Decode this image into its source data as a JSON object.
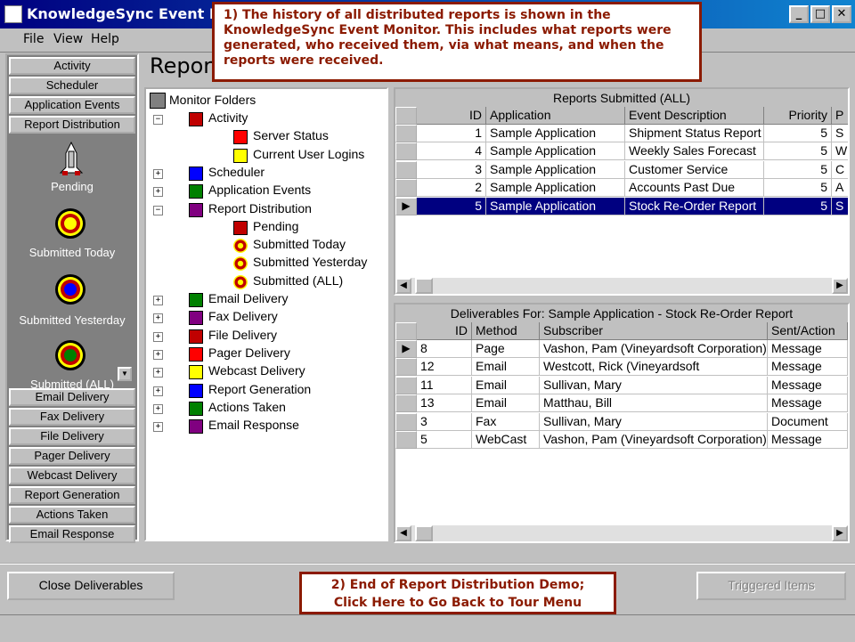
{
  "window": {
    "title": "KnowledgeSync Event Monitor",
    "min": "_",
    "max": "□",
    "close": "✕"
  },
  "menu": [
    "File",
    "View",
    "Help"
  ],
  "nav": {
    "top": [
      "Activity",
      "Scheduler",
      "Application Events",
      "Report Distribution"
    ],
    "icons": [
      {
        "label": "Pending",
        "icon": "shuttle-icon"
      },
      {
        "label": "Submitted Today",
        "icon": "target-icon",
        "center": "#ffff00"
      },
      {
        "label": "Submitted Yesterday",
        "icon": "target-icon",
        "center": "#0000ff"
      },
      {
        "label": "Submitted (ALL)",
        "icon": "target-icon",
        "center": "#008000"
      }
    ],
    "bottom": [
      "Email Delivery",
      "Fax Delivery",
      "File Delivery",
      "Pager Delivery",
      "Webcast Delivery",
      "Report Generation",
      "Actions Taken",
      "Email Response"
    ]
  },
  "heading": "Report",
  "tree": {
    "root": "Monitor Folders",
    "nodes": [
      {
        "label": "Activity",
        "level": 1,
        "pm": "−",
        "icon": "activity-icon"
      },
      {
        "label": "Server Status",
        "level": 2,
        "icon": "server-icon"
      },
      {
        "label": "Current User Logins",
        "level": 2,
        "icon": "users-icon"
      },
      {
        "label": "Scheduler",
        "level": 1,
        "pm": "+",
        "icon": "scheduler-icon"
      },
      {
        "label": "Application Events",
        "level": 1,
        "pm": "+",
        "icon": "events-icon"
      },
      {
        "label": "Report Distribution",
        "level": 1,
        "pm": "−",
        "icon": "report-icon"
      },
      {
        "label": "Pending",
        "level": 2,
        "icon": "shuttle-icon"
      },
      {
        "label": "Submitted Today",
        "level": 2,
        "icon": "target-icon"
      },
      {
        "label": "Submitted Yesterday",
        "level": 2,
        "icon": "target-icon"
      },
      {
        "label": "Submitted (ALL)",
        "level": 2,
        "icon": "target-icon"
      },
      {
        "label": "Email Delivery",
        "level": 1,
        "pm": "+",
        "icon": "email-icon"
      },
      {
        "label": "Fax Delivery",
        "level": 1,
        "pm": "+",
        "icon": "fax-icon"
      },
      {
        "label": "File Delivery",
        "level": 1,
        "pm": "+",
        "icon": "file-icon"
      },
      {
        "label": "Pager Delivery",
        "level": 1,
        "pm": "+",
        "icon": "pager-icon"
      },
      {
        "label": "Webcast Delivery",
        "level": 1,
        "pm": "+",
        "icon": "webcast-icon"
      },
      {
        "label": "Report Generation",
        "level": 1,
        "pm": "+",
        "icon": "report-gen-icon"
      },
      {
        "label": "Actions Taken",
        "level": 1,
        "pm": "+",
        "icon": "actions-icon"
      },
      {
        "label": "Email Response",
        "level": 1,
        "pm": "+",
        "icon": "email-response-icon"
      }
    ]
  },
  "reports": {
    "title": "Reports Submitted (ALL)",
    "columns": [
      "ID",
      "Application",
      "Event Description",
      "Priority",
      "P"
    ],
    "rows": [
      [
        "1",
        "Sample Application",
        "Shipment Status Report",
        "5",
        "S"
      ],
      [
        "4",
        "Sample Application",
        "Weekly Sales Forecast",
        "5",
        "W"
      ],
      [
        "3",
        "Sample Application",
        "Customer Service",
        "5",
        "C"
      ],
      [
        "2",
        "Sample Application",
        "Accounts Past Due",
        "5",
        "A"
      ],
      [
        "5",
        "Sample Application",
        "Stock Re-Order Report",
        "5",
        "S"
      ]
    ],
    "selected_row": 4
  },
  "deliverables": {
    "title": "Deliverables For: Sample Application - Stock Re-Order Report",
    "columns": [
      "ID",
      "Method",
      "Subscriber",
      "Sent/Action"
    ],
    "rows": [
      [
        "8",
        "Page",
        "Vashon, Pam (Vineyardsoft Corporation)",
        "Message"
      ],
      [
        "12",
        "Email",
        "Westcott, Rick (Vineyardsoft",
        "Message"
      ],
      [
        "11",
        "Email",
        "Sullivan, Mary",
        "Message"
      ],
      [
        "13",
        "Email",
        "Matthau, Bill",
        "Message"
      ],
      [
        "3",
        "Fax",
        "Sullivan, Mary",
        "Document"
      ],
      [
        "5",
        "WebCast",
        "Vashon, Pam (Vineyardsoft Corporation)",
        "Message"
      ]
    ],
    "current_row": 0
  },
  "buttons": {
    "close": "Close Deliverables",
    "triggered": "Triggered Items"
  },
  "callout1": "1)  The history of all distributed reports is shown in the KnowledgeSync Event Monitor. This includes what reports were generated, who received them, via what means, and when the reports were received.",
  "callout2_line1": "2)  End of Report Distribution Demo;",
  "callout2_line2": "Click Here to Go Back to Tour Menu",
  "colors": {
    "titlebar": "#000080",
    "selection": "#000080",
    "callout_border": "#8b1a00",
    "callout_text": "#8b1a00"
  }
}
